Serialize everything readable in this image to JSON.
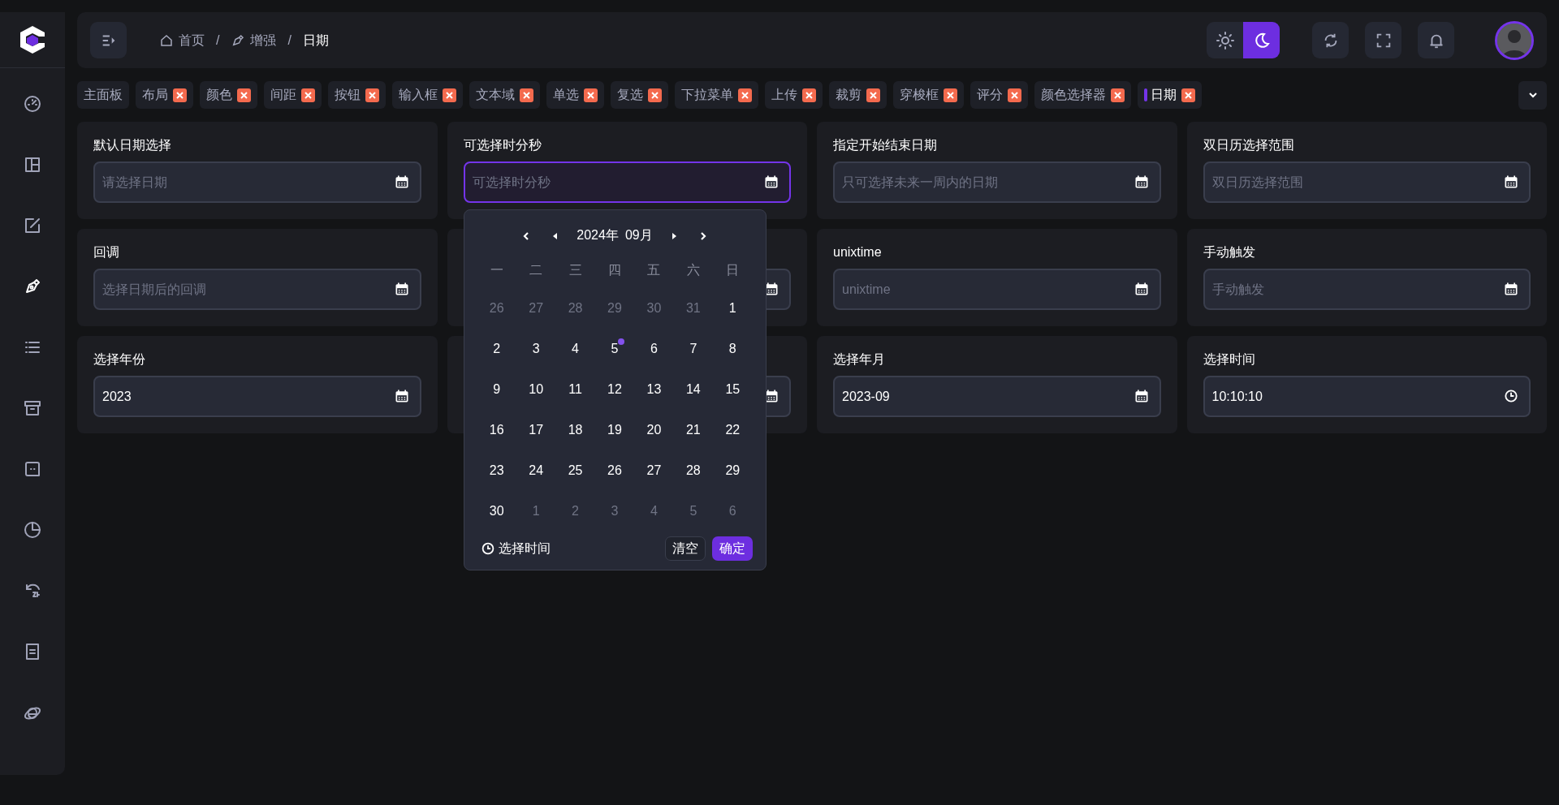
{
  "sidebar": {
    "items": [
      {
        "selected": false
      },
      {
        "selected": false
      },
      {
        "selected": false
      },
      {
        "selected": true
      },
      {
        "selected": false
      },
      {
        "selected": false
      },
      {
        "selected": false
      },
      {
        "selected": false
      },
      {
        "selected": false
      },
      {
        "selected": false
      },
      {
        "selected": false
      }
    ]
  },
  "header": {
    "breadcrumb": [
      {
        "label": "首页",
        "current": false
      },
      {
        "label": "增强",
        "current": false,
        "separator": "/"
      },
      {
        "label": "日期",
        "current": true,
        "separator": "/"
      }
    ],
    "theme_options": [
      {
        "selected": false
      },
      {
        "selected": true
      }
    ]
  },
  "tabs": [
    {
      "label": "主面板",
      "closable": false,
      "selected": false
    },
    {
      "label": "布局",
      "closable": true,
      "selected": false
    },
    {
      "label": "颜色",
      "closable": true,
      "selected": false
    },
    {
      "label": "间距",
      "closable": true,
      "selected": false
    },
    {
      "label": "按钮",
      "closable": true,
      "selected": false
    },
    {
      "label": "输入框",
      "closable": true,
      "selected": false
    },
    {
      "label": "文本域",
      "closable": true,
      "selected": false
    },
    {
      "label": "单选",
      "closable": true,
      "selected": false
    },
    {
      "label": "复选",
      "closable": true,
      "selected": false
    },
    {
      "label": "下拉菜单",
      "closable": true,
      "selected": false
    },
    {
      "label": "上传",
      "closable": true,
      "selected": false
    },
    {
      "label": "裁剪",
      "closable": true,
      "selected": false
    },
    {
      "label": "穿梭框",
      "closable": true,
      "selected": false
    },
    {
      "label": "评分",
      "closable": true,
      "selected": false
    },
    {
      "label": "颜色选择器",
      "closable": true,
      "selected": false
    },
    {
      "label": "日期",
      "closable": true,
      "selected": true
    }
  ],
  "cards": [
    {
      "label": "默认日期选择",
      "placeholder": "请选择日期",
      "kind": "date",
      "focused": false
    },
    {
      "label": "可选择时分秒",
      "placeholder": "可选择时分秒",
      "kind": "date",
      "focused": true
    },
    {
      "label": "指定开始结束日期",
      "placeholder": "只可选择未来一周内的日期",
      "kind": "date",
      "focused": false
    },
    {
      "label": "双日历选择范围",
      "placeholder": "双日历选择范围",
      "kind": "date",
      "focused": false
    },
    {
      "label": "回调",
      "placeholder": "选择日期后的回调",
      "kind": "date",
      "focused": false
    },
    {
      "kind": "date",
      "focused": false
    },
    {
      "label": "unixtime",
      "placeholder": "unixtime",
      "kind": "date",
      "focused": false
    },
    {
      "label": "手动触发",
      "placeholder": "手动触发",
      "kind": "date",
      "focused": false
    },
    {
      "label": "选择年份",
      "value": "2023",
      "kind": "date",
      "focused": false
    },
    {
      "kind": "date",
      "focused": false
    },
    {
      "label": "选择年月",
      "value": "2023-09",
      "kind": "date",
      "focused": false
    },
    {
      "label": "选择时间",
      "value": "10:10:10",
      "kind": "time",
      "focused": false
    }
  ],
  "calendar": {
    "year": "2024年",
    "month": "09月",
    "weekdays": [
      "一",
      "二",
      "三",
      "四",
      "五",
      "六",
      "日"
    ],
    "days": [
      {
        "text": "26",
        "muted": true,
        "today": false
      },
      {
        "text": "27",
        "muted": true,
        "today": false
      },
      {
        "text": "28",
        "muted": true,
        "today": false
      },
      {
        "text": "29",
        "muted": true,
        "today": false
      },
      {
        "text": "30",
        "muted": true,
        "today": false
      },
      {
        "text": "31",
        "muted": true,
        "today": false
      },
      {
        "text": "1",
        "muted": false,
        "today": false
      },
      {
        "text": "2",
        "muted": false,
        "today": false
      },
      {
        "text": "3",
        "muted": false,
        "today": false
      },
      {
        "text": "4",
        "muted": false,
        "today": false
      },
      {
        "text": "5",
        "muted": false,
        "today": true
      },
      {
        "text": "6",
        "muted": false,
        "today": false
      },
      {
        "text": "7",
        "muted": false,
        "today": false
      },
      {
        "text": "8",
        "muted": false,
        "today": false
      },
      {
        "text": "9",
        "muted": false,
        "today": false
      },
      {
        "text": "10",
        "muted": false,
        "today": false
      },
      {
        "text": "11",
        "muted": false,
        "today": false
      },
      {
        "text": "12",
        "muted": false,
        "today": false
      },
      {
        "text": "13",
        "muted": false,
        "today": false
      },
      {
        "text": "14",
        "muted": false,
        "today": false
      },
      {
        "text": "15",
        "muted": false,
        "today": false
      },
      {
        "text": "16",
        "muted": false,
        "today": false
      },
      {
        "text": "17",
        "muted": false,
        "today": false
      },
      {
        "text": "18",
        "muted": false,
        "today": false
      },
      {
        "text": "19",
        "muted": false,
        "today": false
      },
      {
        "text": "20",
        "muted": false,
        "today": false
      },
      {
        "text": "21",
        "muted": false,
        "today": false
      },
      {
        "text": "22",
        "muted": false,
        "today": false
      },
      {
        "text": "23",
        "muted": false,
        "today": false
      },
      {
        "text": "24",
        "muted": false,
        "today": false
      },
      {
        "text": "25",
        "muted": false,
        "today": false
      },
      {
        "text": "26",
        "muted": false,
        "today": false
      },
      {
        "text": "27",
        "muted": false,
        "today": false
      },
      {
        "text": "28",
        "muted": false,
        "today": false
      },
      {
        "text": "29",
        "muted": false,
        "today": false
      },
      {
        "text": "30",
        "muted": false,
        "today": false
      },
      {
        "text": "1",
        "muted": true,
        "today": false
      },
      {
        "text": "2",
        "muted": true,
        "today": false
      },
      {
        "text": "3",
        "muted": true,
        "today": false
      },
      {
        "text": "4",
        "muted": true,
        "today": false
      },
      {
        "text": "5",
        "muted": true,
        "today": false
      },
      {
        "text": "6",
        "muted": true,
        "today": false
      }
    ],
    "time_toggle": "选择时间",
    "clear": "清空",
    "confirm": "确定"
  }
}
